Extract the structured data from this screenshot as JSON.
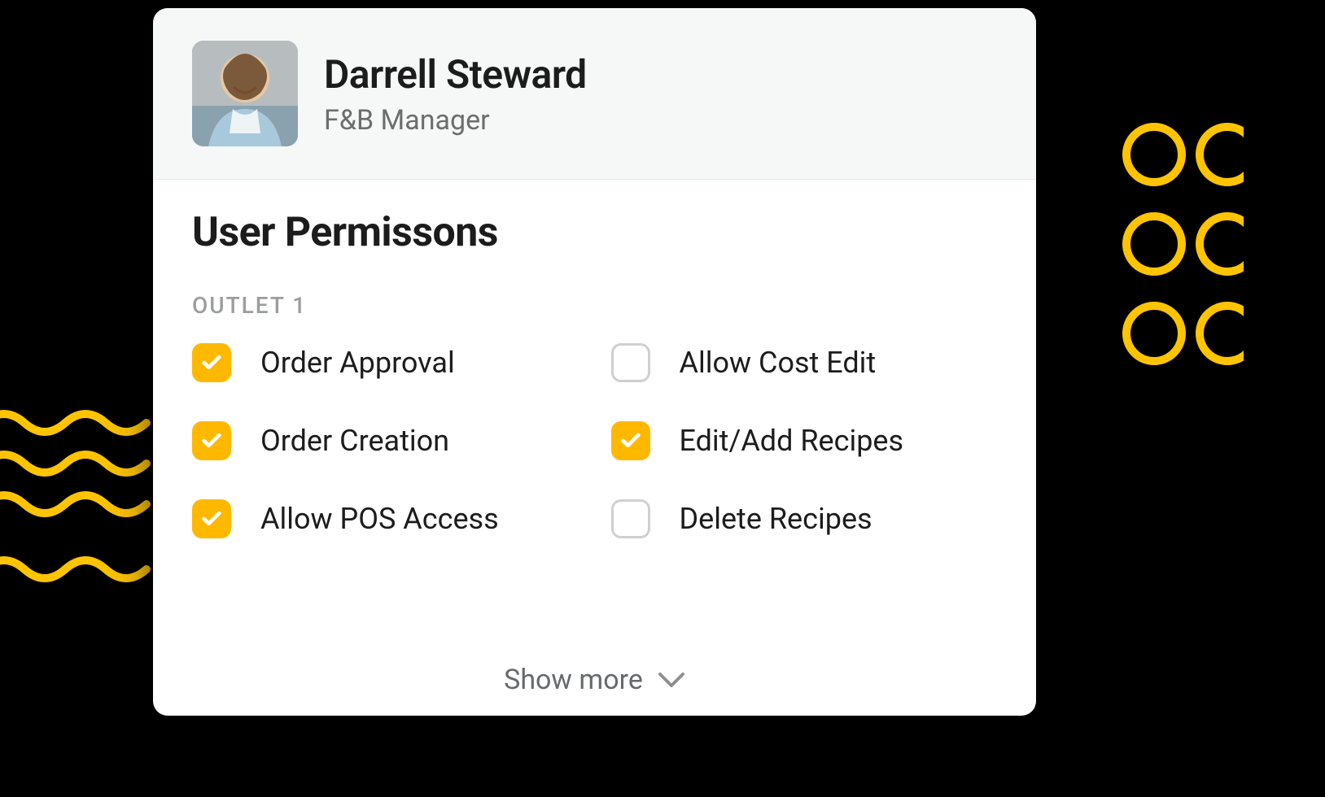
{
  "user": {
    "name": "Darrell Steward",
    "role": "F&B Manager"
  },
  "section_title": "User Permissons",
  "outlet": {
    "label": "OUTLET 1",
    "permissions": [
      {
        "label": "Order Approval",
        "checked": true
      },
      {
        "label": "Allow Cost Edit",
        "checked": false
      },
      {
        "label": "Order Creation",
        "checked": true
      },
      {
        "label": "Edit/Add Recipes",
        "checked": true
      },
      {
        "label": "Allow POS Access",
        "checked": true
      },
      {
        "label": "Delete Recipes",
        "checked": false
      }
    ]
  },
  "show_more_label": "Show more",
  "colors": {
    "accent": "#FFB800"
  }
}
